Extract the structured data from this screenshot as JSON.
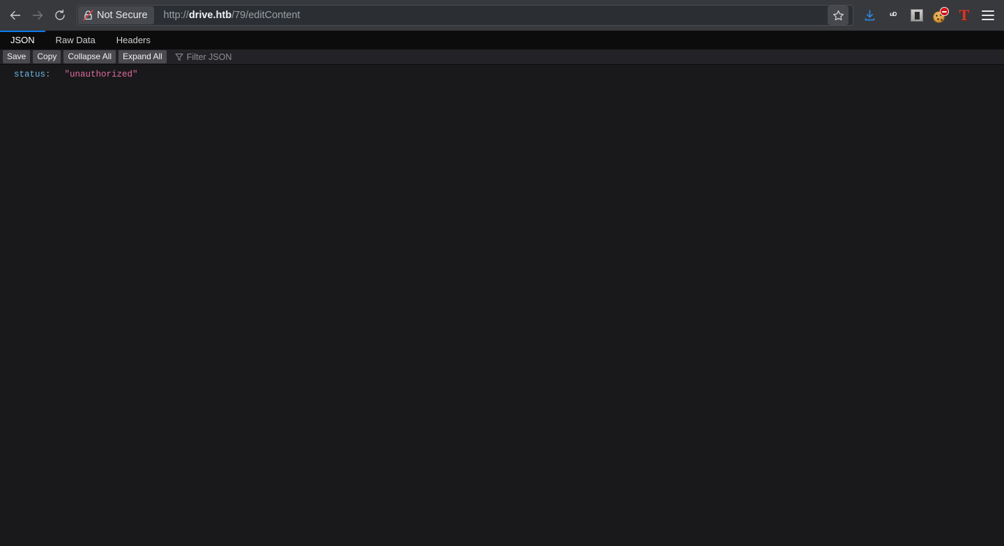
{
  "browser": {
    "nav": {
      "back_icon": "back-arrow-icon",
      "forward_icon": "forward-arrow-icon",
      "reload_icon": "reload-icon"
    },
    "identity": {
      "label": "Not Secure",
      "icon": "lock-slashed-icon"
    },
    "url": {
      "scheme": "http://",
      "host": "drive.htb",
      "path": "/79/editContent",
      "full": "http://drive.htb/79/editContent"
    },
    "toolbar_icons": [
      {
        "name": "bookmark-star-icon"
      },
      {
        "name": "downloads-icon"
      },
      {
        "name": "ublock-origin-icon",
        "badge_text": "uD"
      },
      {
        "name": "extension-grey-square-icon"
      },
      {
        "name": "cookie-blocker-icon"
      },
      {
        "name": "tampermonkey-icon",
        "glyph": "T"
      },
      {
        "name": "app-menu-icon"
      }
    ],
    "colors": {
      "chrome_bg": "#38393d",
      "urlbar_bg": "#2b2f33",
      "download_accent": "#2a8df2",
      "ublock_red": "#8a0e14",
      "t_red": "#d23b2e"
    }
  },
  "json_viewer": {
    "tabs": [
      {
        "label": "JSON",
        "active": true
      },
      {
        "label": "Raw Data",
        "active": false
      },
      {
        "label": "Headers",
        "active": false
      }
    ],
    "toolbar": {
      "save_label": "Save",
      "copy_label": "Copy",
      "collapse_all_label": "Collapse All",
      "expand_all_label": "Expand All",
      "filter_placeholder": "Filter JSON",
      "filter_value": "",
      "filter_icon": "funnel-icon"
    },
    "rows": [
      {
        "key": "status",
        "colon": ":",
        "value": "\"unauthorized\""
      }
    ],
    "colors": {
      "bg": "#19191b",
      "tabbar_bg": "#0c0c0d",
      "active_tab_underline": "#0a7bf0",
      "key": "#6ab7e6",
      "string": "#e36ba0"
    }
  }
}
